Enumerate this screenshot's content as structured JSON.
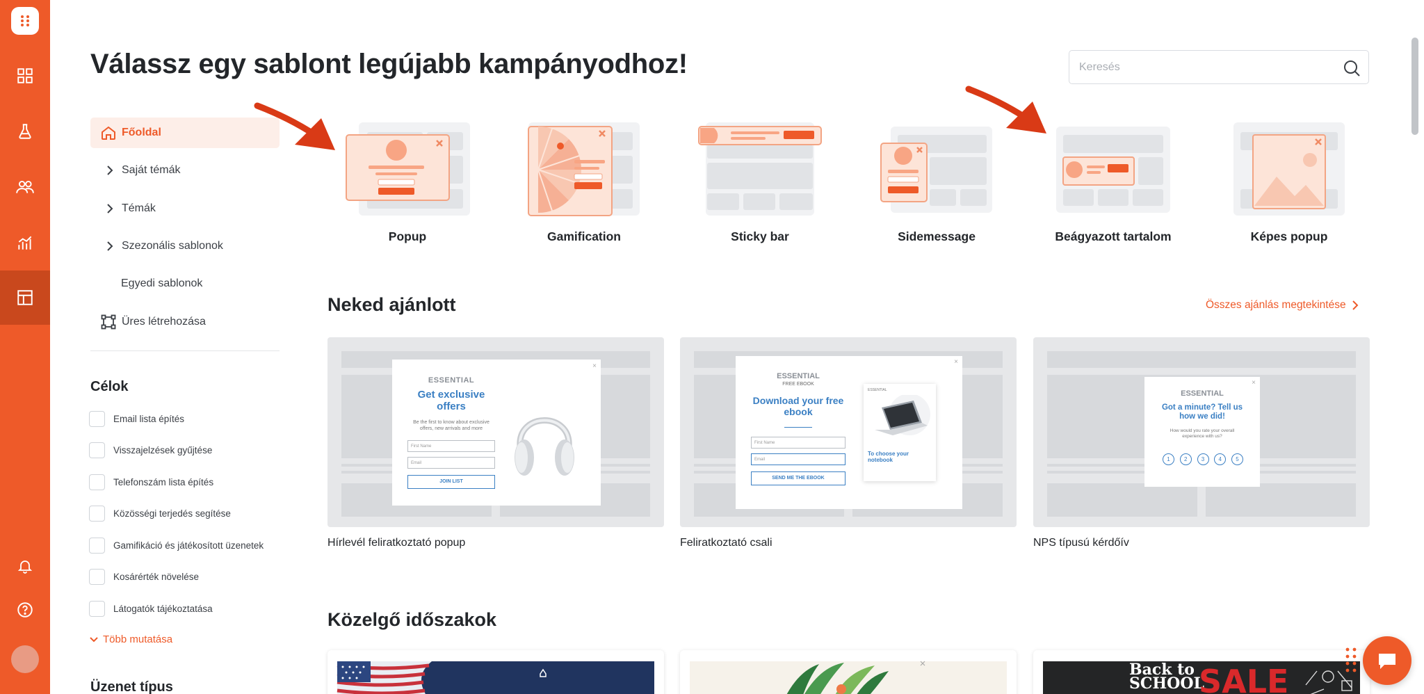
{
  "page": {
    "title": "Válassz egy sablont legújabb kampányodhoz!",
    "search_placeholder": "Keresés"
  },
  "sidebar": {
    "nav": [
      {
        "label": "Főoldal",
        "icon": "home-icon",
        "active": true
      },
      {
        "label": "Saját témák",
        "icon": "chevron-right-icon"
      },
      {
        "label": "Témák",
        "icon": "chevron-right-icon"
      },
      {
        "label": "Szezonális sablonok",
        "icon": "chevron-right-icon"
      },
      {
        "label": "Egyedi sablonok",
        "icon": ""
      },
      {
        "label": "Üres létrehozása",
        "icon": "blank-frame-icon"
      }
    ],
    "goals_title": "Célok",
    "goals": [
      "Email lista építés",
      "Visszajelzések gyűjtése",
      "Telefonszám lista építés",
      "Közösségi terjedés segítése",
      "Gamifikáció és játékosított üzenetek",
      "Kosárérték növelése",
      "Látogatók tájékoztatása"
    ],
    "more_label": "Több mutatása",
    "message_type_title": "Üzenet típus"
  },
  "types": [
    {
      "label": "Popup"
    },
    {
      "label": "Gamification"
    },
    {
      "label": "Sticky bar"
    },
    {
      "label": "Sidemessage"
    },
    {
      "label": "Beágyazott tartalom"
    },
    {
      "label": "Képes popup"
    }
  ],
  "recommended": {
    "title": "Neked ajánlott",
    "see_all": "Összes ajánlás megtekintése",
    "cards": [
      {
        "title": "Hírlevél feliratkoztató popup",
        "preview": {
          "brand": "ESSENTIAL",
          "headline": "Get exclusive offers",
          "body": "Be the first to know about exclusive offers, new arrivals and more",
          "field1": "First Name",
          "field2": "Email",
          "button": "JOIN LIST"
        }
      },
      {
        "title": "Feliratkoztató csali",
        "preview": {
          "brand": "ESSENTIAL",
          "sub": "FREE EBOOK",
          "headline": "Download your free ebook",
          "field1": "First Name",
          "field2": "Email",
          "button": "SEND ME THE EBOOK",
          "book_brand": "ESSENTIAL",
          "book_title": "To choose your notebook"
        }
      },
      {
        "title": "NPS típusú kérdőív",
        "preview": {
          "brand": "ESSENTIAL",
          "headline": "Got a minute? Tell us how we did!",
          "body": "How would you rate your overall experience with us?",
          "scale": [
            "1",
            "2",
            "3",
            "4",
            "5"
          ]
        }
      }
    ]
  },
  "upcoming": {
    "title": "Közelgő időszakok",
    "cards": [
      {
        "theme": "usa-flag"
      },
      {
        "theme": "tropical-leaves"
      },
      {
        "theme": "back-to-school",
        "text1": "Back to",
        "text2": "SCHOOL",
        "text3": "SALE"
      }
    ]
  },
  "colors": {
    "brand": "#ee5a29",
    "brand_dark": "#c9481d",
    "tile_accent": "#f8a584",
    "preview_blue": "#3a7fc3"
  }
}
